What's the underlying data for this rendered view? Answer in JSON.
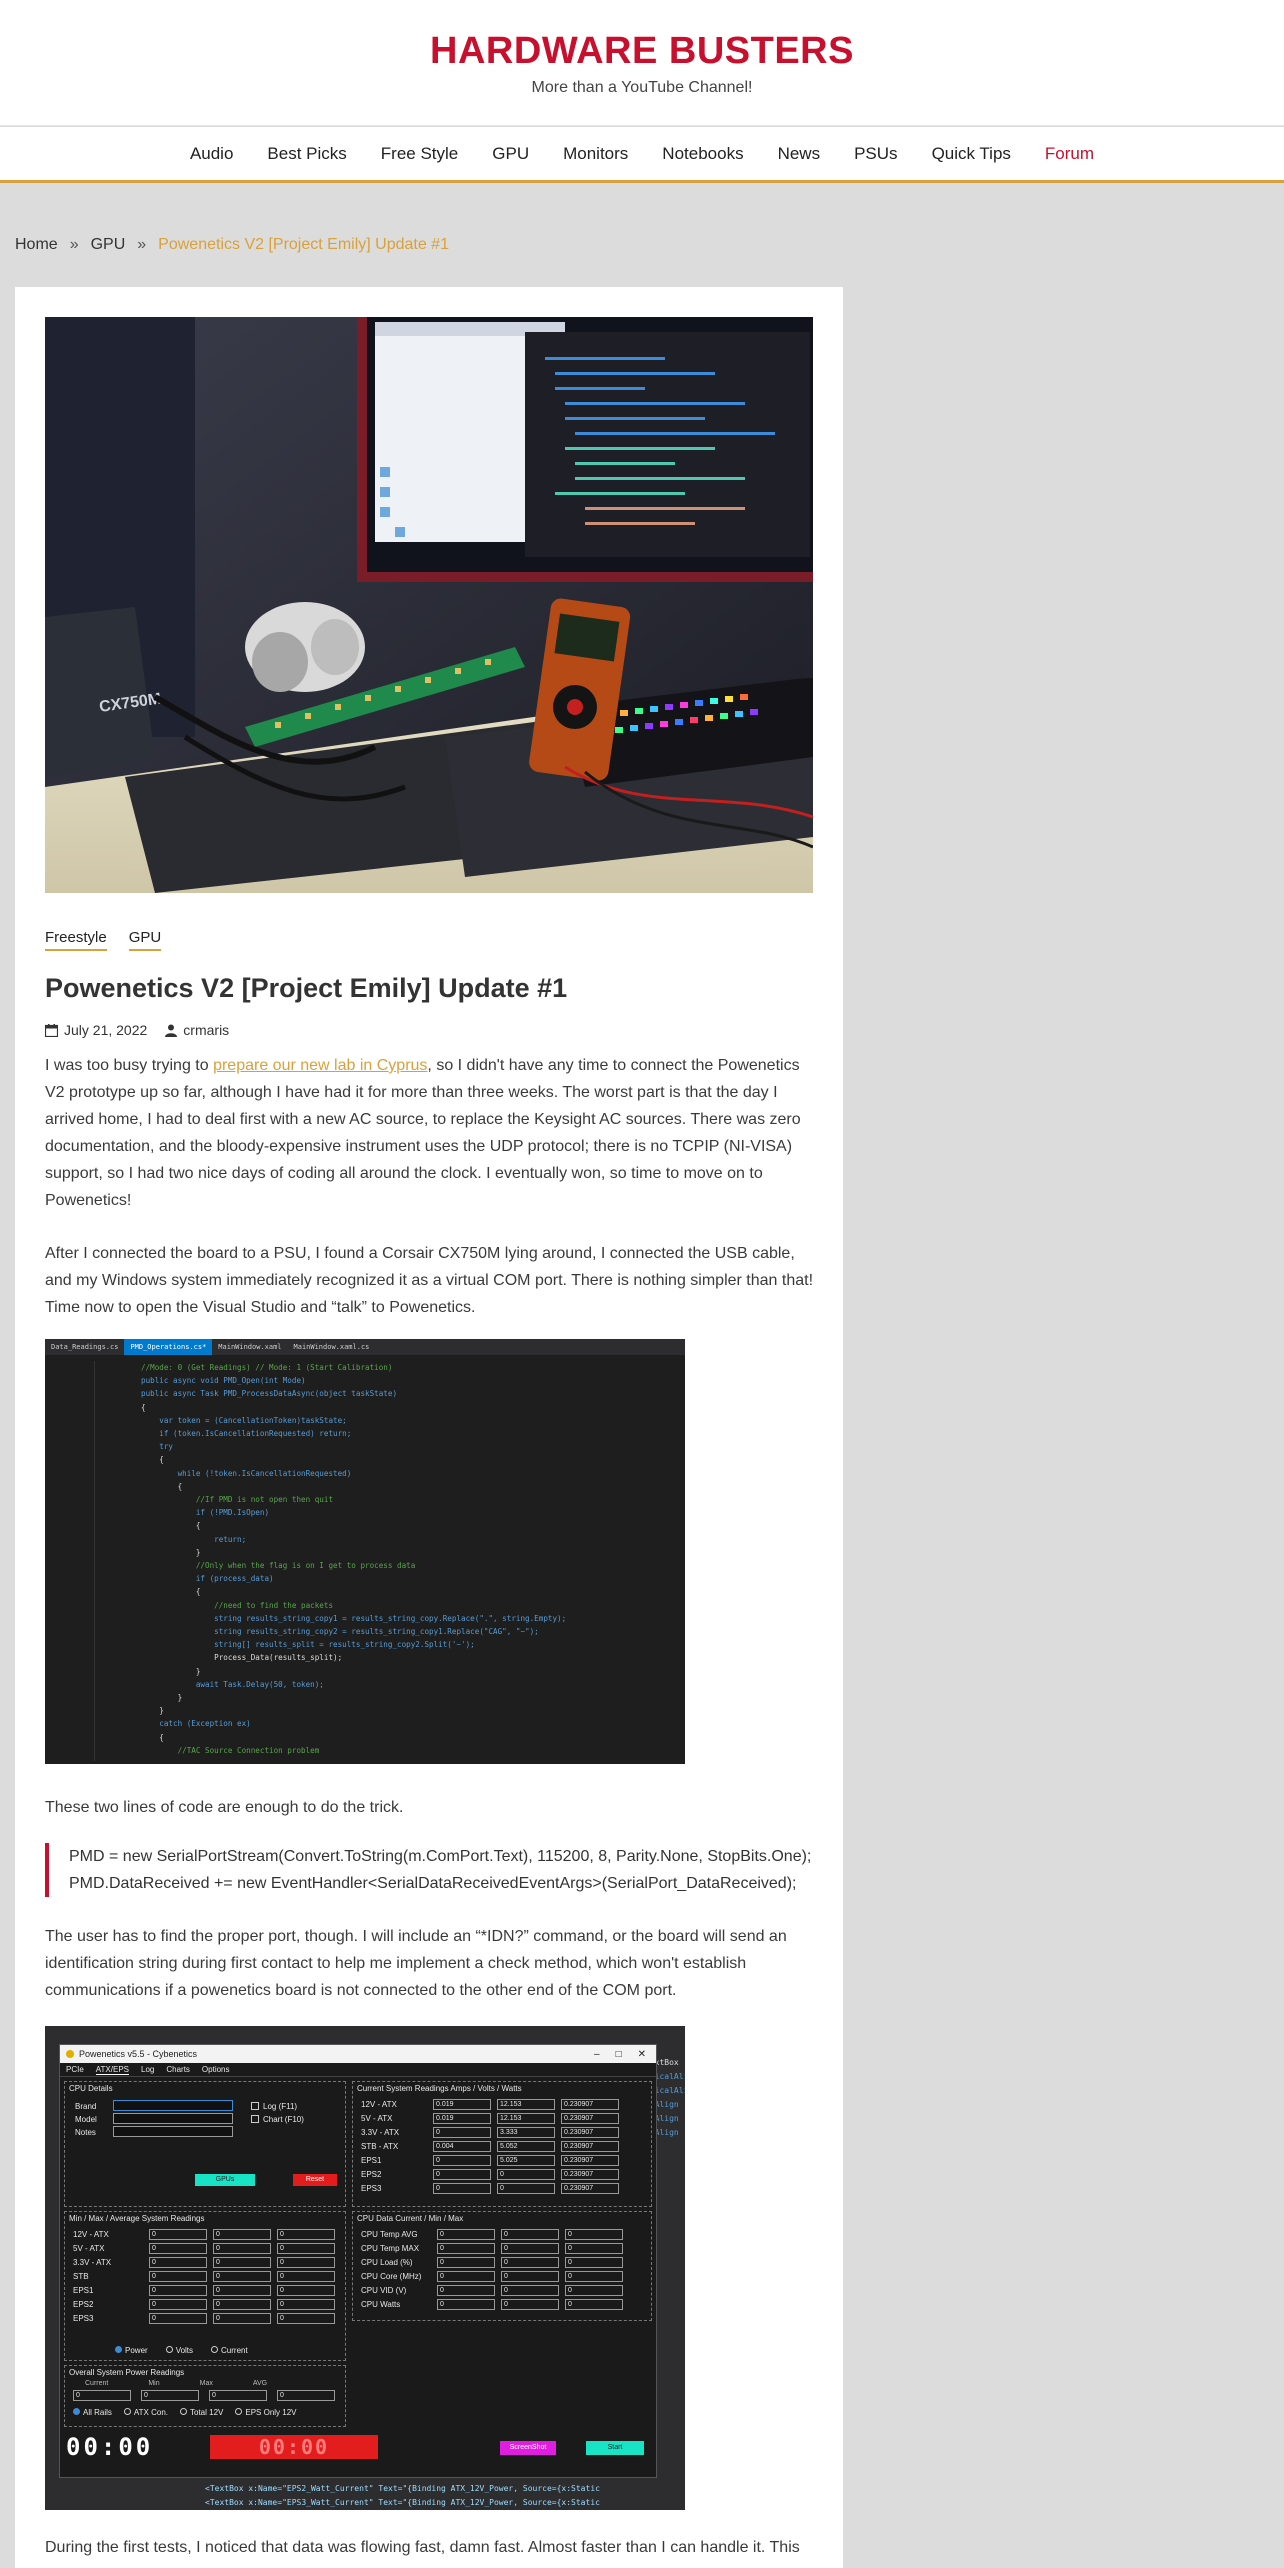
{
  "site": {
    "title": "HARDWARE BUSTERS",
    "tagline": "More than a YouTube Channel!"
  },
  "nav": {
    "items": [
      "Audio",
      "Best Picks",
      "Free Style",
      "GPU",
      "Monitors",
      "Notebooks",
      "News",
      "PSUs",
      "Quick Tips",
      "Forum"
    ]
  },
  "breadcrumb": {
    "home": "Home",
    "section": "GPU",
    "current": "Powenetics V2 [Project Emily] Update #1"
  },
  "article": {
    "categories": [
      "Freestyle",
      "GPU"
    ],
    "title": "Powenetics V2 [Project Emily] Update #1",
    "date": "July 21, 2022",
    "author": "crmaris",
    "p1_before": "I was too busy trying to ",
    "p1_link": "prepare our new lab in Cyprus",
    "p1_after": ", so I didn't have any time to connect the Powenetics V2 prototype up so far, although I have had it for more than three weeks. The worst part is that the day I arrived home, I had to deal first with a new AC source, to replace the Keysight AC sources. There was zero documentation, and the bloody-expensive instrument uses the UDP protocol; there is no TCPIP (NI-VISA) support, so I had two nice days of coding all around the clock. I eventually won, so time to move on to Powenetics!",
    "p2": "After I connected the board to a PSU, I found a Corsair CX750M lying around, I connected the USB cable, and my Windows system immediately recognized it as a virtual COM port. There is nothing simpler than that! Time now to open the Visual Studio and “talk” to Powenetics.",
    "p3": "These two lines of code are enough to do the trick.",
    "quote_line1": "PMD = new SerialPortStream(Convert.ToString(m.ComPort.Text), 115200, 8, Parity.None, StopBits.One);",
    "quote_line2": "PMD.DataReceived += new EventHandler<SerialDataReceivedEventArgs>(SerialPort_DataReceived);",
    "p4": "The user has to find the proper port, though. I will include an “*IDN?” command, or the board will send an identification string during first contact to help me implement a check method, which won't establish communications if a powenetics board is not connected to the other end of the COM port.",
    "p5": "During the first tests, I noticed that data was flowing fast, damn fast. Almost faster than I can handle it. This"
  },
  "hero_photo": {
    "psu_label": "CX750M"
  },
  "code_shot": {
    "tabs": [
      "Data_Readings.cs",
      "PMD_Operations.cs*",
      "MainWindow.xaml",
      "MainWindow.xaml.cs"
    ],
    "lines": [
      "//Mode: 0 (Get Readings) // Mode: 1 (Start Calibration)",
      "public async void PMD_Open(int Mode)",
      "public async Task PMD_ProcessDataAsync(object taskState)",
      "{",
      "    var token = (CancellationToken)taskState;",
      "    if (token.IsCancellationRequested) return;",
      "    try",
      "    {",
      "        while (!token.IsCancellationRequested)",
      "        {",
      "            //If PMD is not open then quit",
      "            if (!PMD.IsOpen)",
      "            {",
      "                return;",
      "            }",
      "            //Only when the flag is on I get to process data",
      "            if (process_data)",
      "            {",
      "                //need to find the packets",
      "                string results_string_copy1 = results_string_copy.Replace(\".\", string.Empty);",
      "                string results_string_copy2 = results_string_copy1.Replace(\"CAG\", \"~\");",
      "                string[] results_split = results_string_copy2.Split('~');",
      "                Process_Data(results_split);",
      "            }",
      "            await Task.Delay(50, token);",
      "        }",
      "    }",
      "    catch (Exception ex)",
      "    {",
      "        //TAC Source Connection problem"
    ]
  },
  "app_shot": {
    "window_title": "Powenetics v5.5 - Cybenetics",
    "menu": [
      "PCIe",
      "ATX/EPS",
      "Log",
      "Charts",
      "Options"
    ],
    "cpu_details": {
      "title": "CPU Details",
      "labels": [
        "Brand",
        "Model",
        "Notes"
      ],
      "checks": [
        "Log (F11)",
        "Chart (F10)"
      ],
      "gpu_btn": "GPUs",
      "reset_btn": "Reset"
    },
    "current_readings": {
      "title": "Current System Readings Amps / Volts / Watts",
      "rows": [
        {
          "label": "12V - ATX",
          "a": "0.019",
          "v": "12.153",
          "w": "0.230907"
        },
        {
          "label": "5V - ATX",
          "a": "0.019",
          "v": "12.153",
          "w": "0.230907"
        },
        {
          "label": "3.3V - ATX",
          "a": "0",
          "v": "3.333",
          "w": "0.230907"
        },
        {
          "label": "STB - ATX",
          "a": "0.004",
          "v": "5.052",
          "w": "0.230907"
        },
        {
          "label": "EPS1",
          "a": "0",
          "v": "5.025",
          "w": "0.230907"
        },
        {
          "label": "EPS2",
          "a": "0",
          "v": "0",
          "w": "0.230907"
        },
        {
          "label": "EPS3",
          "a": "0",
          "v": "0",
          "w": "0.230907"
        }
      ]
    },
    "minmax": {
      "title": "Min / Max / Average System Readings",
      "labels": [
        "12V - ATX",
        "5V - ATX",
        "3.3V - ATX",
        "STB",
        "EPS1",
        "EPS2",
        "EPS3"
      ],
      "radios": [
        "Power",
        "Volts",
        "Current"
      ]
    },
    "cpu_data": {
      "title": "CPU Data Current / Min / Max",
      "labels": [
        "CPU Temp AVG",
        "CPU Temp MAX",
        "CPU Load (%)",
        "CPU Core (MHz)",
        "CPU VID (V)",
        "CPU Watts"
      ]
    },
    "overall": {
      "title": "Overall System Power Readings",
      "cols": [
        "Current",
        "Min",
        "Max",
        "AVG"
      ],
      "radios": [
        "All Rails",
        "ATX Con.",
        "Total 12V",
        "EPS Only 12V"
      ]
    },
    "counter": "00:00",
    "screenshot_btn": "ScreenShot",
    "start_btn": "Start",
    "side_code": [
      "TextBox",
      "rticalAli",
      "rticalAli",
      "alAlign",
      "alAlign",
      "alAlign"
    ],
    "bottom_code_1": "<TextBox x:Name=\"EPS2_Watt_Current\" Text=\"{Binding ATX_12V_Power, Source={x:Static",
    "bottom_code_2": "<TextBox x:Name=\"EPS3_Watt_Current\" Text=\"{Binding ATX_12V_Power, Source={x:Static"
  }
}
